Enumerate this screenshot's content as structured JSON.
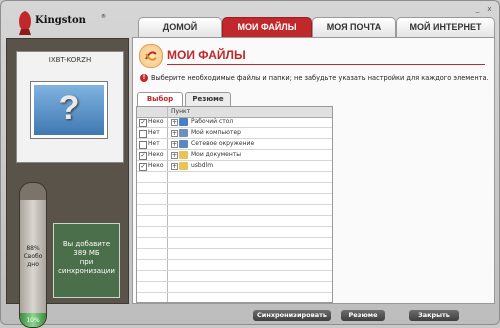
{
  "window": {
    "minimize_label": "_",
    "close_label": "x"
  },
  "logo": {
    "text": "Kingston",
    "reg": "®"
  },
  "nav": {
    "tabs": [
      {
        "label": "ДОМОЙ"
      },
      {
        "label": "МОИ ФАЙЛЫ"
      },
      {
        "label": "МОЯ ПОЧТА"
      },
      {
        "label": "МОЙ ИНТЕРНЕТ"
      }
    ],
    "active_index": 1
  },
  "device": {
    "name": "IXBT-KORZH",
    "image_glyph": "?"
  },
  "gauge": {
    "free_percent": 88,
    "free_label": "88%",
    "free_word": "Свобо",
    "free_word2": "дно",
    "low_label": "10%"
  },
  "sync_info": {
    "line1": "Вы добавите",
    "line2": "389 МБ",
    "line3": "при",
    "line4": "синхронизации"
  },
  "main": {
    "title": "МОИ ФАЙЛЫ",
    "info_glyph": "!",
    "info_text": "Выберите необходимые файлы и папки; не забудьте указать настройки для каждого элемента.",
    "tabs": [
      {
        "label": "Выбор"
      },
      {
        "label": "Резюме"
      }
    ],
    "grid": {
      "header_item": "Пункт",
      "rows": [
        {
          "checked": true,
          "check_glyph": "✓",
          "state": "Неко",
          "expand": "+",
          "name": "Рабочий стол",
          "icon": "desktop-icon",
          "icon_color": "#4a7fc4"
        },
        {
          "checked": false,
          "check_glyph": "",
          "state": "Нет",
          "expand": "+",
          "name": "Мой компьютер",
          "icon": "computer-icon",
          "icon_color": "#6b8fbf"
        },
        {
          "checked": false,
          "check_glyph": "",
          "state": "Нет",
          "expand": "+",
          "name": "Сетевое окружение",
          "icon": "network-icon",
          "icon_color": "#5a86c2"
        },
        {
          "checked": true,
          "check_glyph": "✓",
          "state": "Неко",
          "expand": "+",
          "name": "Мои документы",
          "icon": "documents-folder-icon",
          "icon_color": "#e8c35a"
        },
        {
          "checked": true,
          "check_glyph": "✓",
          "state": "Неко",
          "expand": "+",
          "name": "usbdlm",
          "icon": "folder-icon",
          "icon_color": "#e8c35a"
        }
      ]
    }
  },
  "buttons": {
    "sync": "Синхронизировать",
    "summary": "Резюме",
    "close": "Закрыть"
  },
  "colors": {
    "accent": "#c0282b",
    "panel": "#5a5349",
    "sync_box": "#4b6e4b"
  }
}
